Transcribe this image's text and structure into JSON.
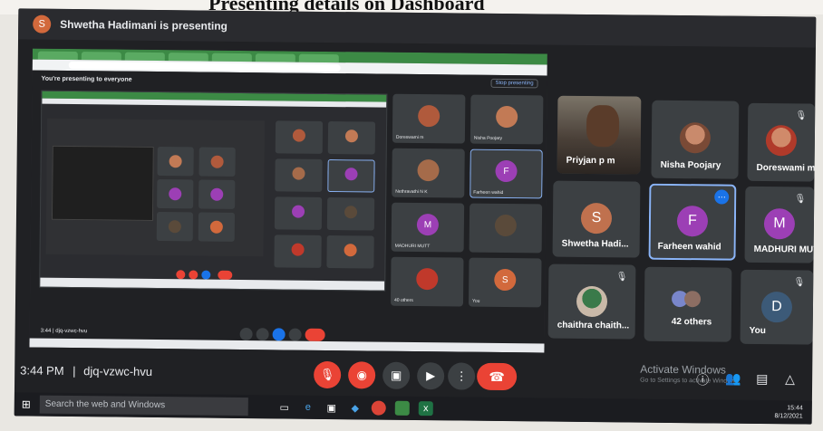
{
  "page": {
    "title": "Presenting details on Dashboard"
  },
  "presenting_bar": {
    "avatar_letter": "S",
    "text": "Shwetha Hadimani is presenting"
  },
  "shared_screen": {
    "banner": "You're presenting to everyone",
    "stop_label": "Stop presenting",
    "inner_tiles": [
      {
        "name": "Doreswami m",
        "letter": "",
        "color": "#b05a3c"
      },
      {
        "name": "Nisha Poojary",
        "letter": "",
        "color": "#c27a55"
      },
      {
        "name": "Nethravathi N K",
        "letter": "",
        "color": "#a56b4a"
      },
      {
        "name": "Farheen wahid",
        "letter": "F",
        "color": "#9c3fb5"
      },
      {
        "name": "MADHURI MUTT",
        "letter": "M",
        "color": "#9c3fb5"
      },
      {
        "name": "",
        "letter": "",
        "color": "#5a4a3a"
      },
      {
        "name": "40 others",
        "letter": "",
        "color": "#c0392b"
      },
      {
        "name": "You",
        "letter": "S",
        "color": "#d2693c"
      }
    ],
    "inner_time": "3:44",
    "inner_code": "djq-vzwc-hvu"
  },
  "tiles": [
    {
      "name": "Priyjan p m",
      "type": "video",
      "mic_off": false,
      "active": false
    },
    {
      "name": "Nisha Poojary",
      "type": "photo",
      "mic_off": false,
      "active": false
    },
    {
      "name": "Doreswami m",
      "type": "photo",
      "mic_off": true,
      "active": false
    },
    {
      "name": "Shwetha Hadi...",
      "type": "letter",
      "letter": "S",
      "color": "#c0714e",
      "mic_off": false,
      "active": false
    },
    {
      "name": "Farheen wahid",
      "type": "letter",
      "letter": "F",
      "color": "#9c3fb5",
      "mic_off": false,
      "active": true
    },
    {
      "name": "MADHURI MUTT",
      "type": "letter",
      "letter": "M",
      "color": "#9c3fb5",
      "mic_off": true,
      "active": false
    },
    {
      "name": "chaithra chaith...",
      "type": "photo",
      "mic_off": true,
      "active": false
    },
    {
      "name": "42 others",
      "type": "others",
      "mic_off": false,
      "active": false
    },
    {
      "name": "You",
      "type": "letter",
      "letter": "D",
      "color": "#3c5a78",
      "mic_off": true,
      "active": false
    }
  ],
  "bottom_bar": {
    "time": "3:44 PM",
    "separator": "|",
    "meeting_code": "djq-vzwc-hvu",
    "activate_title": "Activate Windows",
    "activate_sub": "Go to Settings to activate Windows."
  },
  "taskbar": {
    "search_placeholder": "Search the web and Windows",
    "clock_time": "15:44",
    "clock_date": "8/12/2021"
  },
  "colors": {
    "accent": "#8ab4f8",
    "danger": "#ea4335",
    "tile_bg": "#3c4043",
    "screen_bg": "#202124"
  }
}
